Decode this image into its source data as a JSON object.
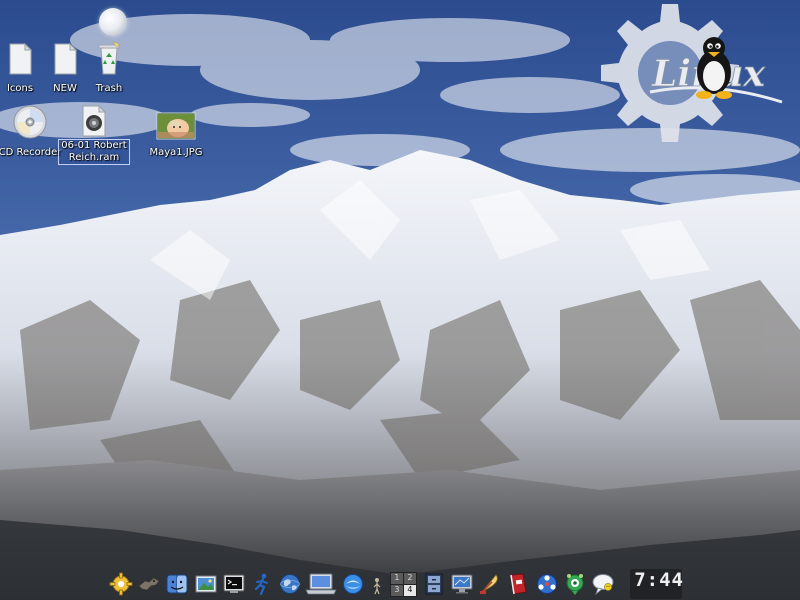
{
  "desktop": {
    "icons": [
      {
        "label": "Icons",
        "type": "file"
      },
      {
        "label": "NEW",
        "type": "file"
      },
      {
        "label": "Trash",
        "type": "trash"
      },
      {
        "label": "CD Recorder",
        "type": "cd"
      },
      {
        "label": "06-01 Robert\nReich.ram",
        "type": "audio-file"
      },
      {
        "label": "Maya1.JPG",
        "type": "image-file"
      }
    ],
    "logo_text": "Linux",
    "wallpaper": "snowy mountain under blue sky"
  },
  "panel": {
    "launchers": [
      {
        "icon": "kde-gear-icon"
      },
      {
        "icon": "wolf-icon"
      },
      {
        "icon": "finder-face-icon"
      },
      {
        "icon": "photo-viewer-icon"
      },
      {
        "icon": "terminal-icon"
      },
      {
        "icon": "running-man-icon"
      },
      {
        "icon": "globe-icon"
      },
      {
        "icon": "laptop-icon"
      },
      {
        "icon": "blue-swirl-icon"
      },
      {
        "icon": "small-figure-icon"
      }
    ],
    "pager": {
      "desktops": [
        "1",
        "2",
        "3",
        "4"
      ],
      "active": "4"
    },
    "tray": [
      {
        "icon": "document-cabinet-icon"
      },
      {
        "icon": "monitor-icon"
      },
      {
        "icon": "feather-pen-icon"
      },
      {
        "icon": "red-book-icon"
      },
      {
        "icon": "network-ball-icon"
      },
      {
        "icon": "green-chat-icon"
      },
      {
        "icon": "speech-bubble-icon"
      }
    ],
    "clock": {
      "time": "7:44",
      "date": ""
    }
  },
  "colors": {
    "sky_top": "#2f4f93",
    "sky_bottom": "#7f9bc8",
    "snow": "#eef2f8",
    "rock": "#5f5a55",
    "label_text": "#ffffff"
  }
}
